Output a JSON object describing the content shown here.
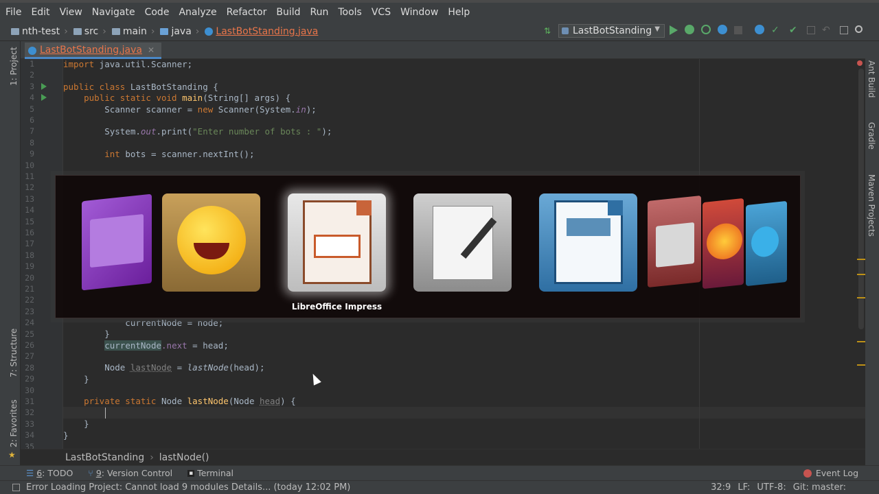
{
  "menu": [
    "File",
    "Edit",
    "View",
    "Navigate",
    "Code",
    "Analyze",
    "Refactor",
    "Build",
    "Run",
    "Tools",
    "VCS",
    "Window",
    "Help"
  ],
  "breadcrumbs": [
    "nth-test",
    "src",
    "main",
    "java",
    "LastBotStanding.java"
  ],
  "run_config": "LastBotStanding",
  "left_tools": [
    "1: Project",
    "7: Structure",
    "2: Favorites"
  ],
  "right_tools": [
    "Ant Build",
    "Gradle",
    "Maven Projects"
  ],
  "tab": {
    "label": "LastBotStanding.java"
  },
  "line_numbers": [
    "1",
    "2",
    "3",
    "4",
    "5",
    "6",
    "7",
    "8",
    "9",
    "10",
    "11",
    "12",
    "13",
    "14",
    "15",
    "16",
    "17",
    "18",
    "19",
    "20",
    "21",
    "22",
    "23",
    "24",
    "25",
    "26",
    "27",
    "28",
    "29",
    "30",
    "31",
    "32",
    "33",
    "34",
    "35"
  ],
  "code": {
    "l1_import": "import",
    "l1_rest": " java.util.Scanner;",
    "l3_kw": "public class",
    "l3_rest": " LastBotStanding {",
    "l4_kw": "    public static void ",
    "l4_fn": "main",
    "l4_rest": "(String[] args) {",
    "l5_a": "        Scanner scanner = ",
    "l5_new": "new",
    "l5_b": " Scanner(System.",
    "l5_in": "in",
    "l5_c": ");",
    "l7_a": "        System.",
    "l7_out": "out",
    "l7_b": ".print(",
    "l7_str": "\"Enter number of bots : \"",
    "l7_c": ");",
    "l9_kw": "        int",
    "l9_rest": " bots = scanner.nextInt();",
    "l24": "            currentNode = node;",
    "l25": "        }",
    "l26_hl": "currentNode",
    "l26_next": ".next",
    "l26_rest": " = head;",
    "l28_a": "        Node ",
    "l28_unused": "lastNode",
    "l28_b": " = ",
    "l28_call": "lastNode",
    "l28_c": "(head);",
    "l29": "    }",
    "l31_kw": "    private static",
    "l31_a": " Node ",
    "l31_fn": "lastNode",
    "l31_b": "(Node ",
    "l31_param": "head",
    "l31_c": ") {",
    "l33": "    }",
    "l34": "}"
  },
  "editor_breadcrumb": [
    "LastBotStanding",
    "lastNode()"
  ],
  "tool_windows": [
    {
      "key": "6",
      "label": ": TODO"
    },
    {
      "key": "9",
      "label": ": Version Control"
    },
    {
      "key": "",
      "label": "Terminal"
    }
  ],
  "event_log": "Event Log",
  "status": {
    "message": "Error Loading Project: Cannot load 9 modules Details... (today 12:02 PM)",
    "position": "32:9",
    "line_sep": "LF:",
    "encoding": "UTF-8:",
    "git": "Git: master:"
  },
  "switcher": {
    "selected_label": "LibreOffice Impress",
    "apps": [
      "app-window-icon",
      "emoji-laughing-icon",
      "libreoffice-impress-icon",
      "text-editor-icon",
      "libreoffice-writer-icon",
      "file-cabinet-icon",
      "firefox-icon",
      "skype-icon"
    ]
  },
  "colors": {
    "accent": "#4a88c7",
    "keyword": "#cc7832",
    "string": "#6a8759",
    "function": "#ffc66d",
    "field": "#9876aa",
    "filename": "#e8754a"
  }
}
